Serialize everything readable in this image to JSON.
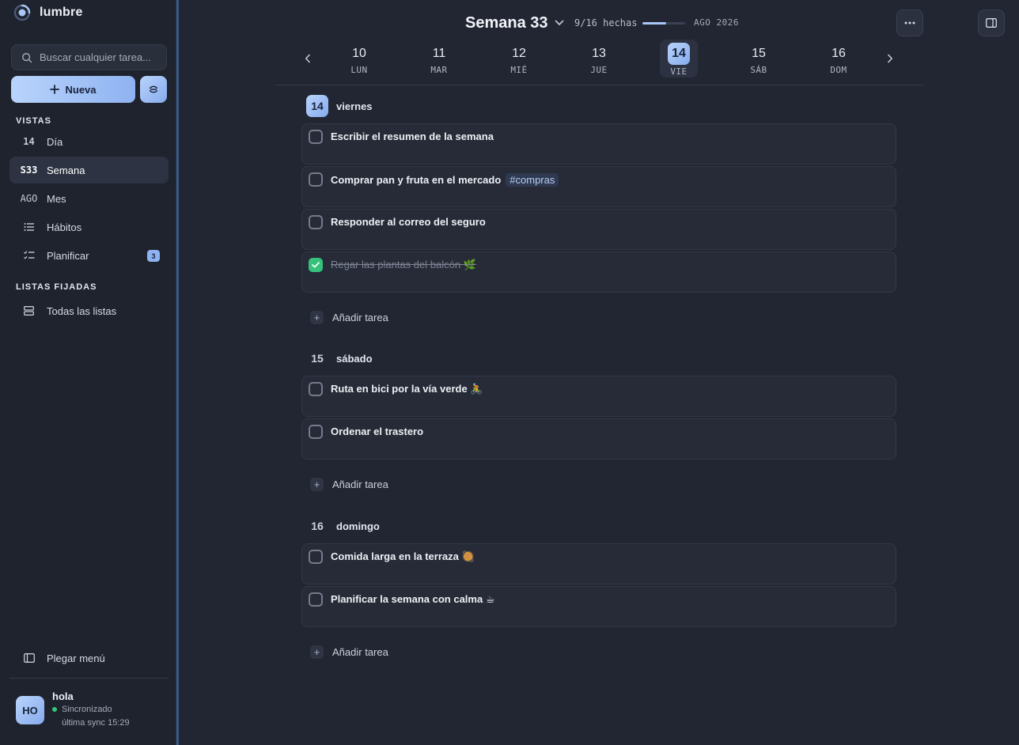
{
  "app": {
    "name": "lumbre"
  },
  "search": {
    "placeholder": "Buscar cualquier tarea..."
  },
  "sidebar": {
    "new_button": "Nueva",
    "views_label": "VISTAS",
    "views": [
      {
        "icon_text": "14",
        "label": "Día",
        "active": false
      },
      {
        "icon_text": "S33",
        "label": "Semana",
        "active": true
      },
      {
        "icon_text": "AGO",
        "label": "Mes",
        "active": false
      },
      {
        "icon": "list-icon",
        "label": "Hábitos",
        "active": false
      },
      {
        "icon": "checklist-icon",
        "label": "Planificar",
        "active": false,
        "badge": "3"
      }
    ],
    "pinned_label": "LISTAS FIJADAS",
    "pinned": [
      {
        "icon": "stack-icon",
        "label": "Todas las listas"
      }
    ],
    "collapse_label": "Plegar menú",
    "user": {
      "initials": "HO",
      "name": "hola",
      "status": "Sincronizado",
      "last_sync": "última sync 15:29"
    }
  },
  "header": {
    "week_title": "Semana 33",
    "progress_text": "9/16 hechas",
    "progress_fraction": 0.5625,
    "month": "AGO 2026"
  },
  "week": [
    {
      "num": "10",
      "dow": "LUN",
      "selected": false
    },
    {
      "num": "11",
      "dow": "MAR",
      "selected": false
    },
    {
      "num": "12",
      "dow": "MIÉ",
      "selected": false
    },
    {
      "num": "13",
      "dow": "JUE",
      "selected": false
    },
    {
      "num": "14",
      "dow": "VIE",
      "selected": true
    },
    {
      "num": "15",
      "dow": "SÁB",
      "selected": false
    },
    {
      "num": "16",
      "dow": "DOM",
      "selected": false
    }
  ],
  "add_task_label": "Añadir tarea",
  "days": [
    {
      "num": "14",
      "name": "viernes",
      "today": true,
      "tasks": [
        {
          "text": "Escribir el resumen de la semana",
          "done": false
        },
        {
          "text": "Comprar pan y fruta en el mercado",
          "tag": "#compras",
          "done": false
        },
        {
          "text": "Responder al correo del seguro",
          "done": false
        },
        {
          "text": "Regar las plantas del balcón 🌿",
          "done": true
        }
      ]
    },
    {
      "num": "15",
      "name": "sábado",
      "today": false,
      "tasks": [
        {
          "text": "Ruta en bici por la vía verde 🚴",
          "done": false
        },
        {
          "text": "Ordenar el trastero",
          "done": false
        }
      ]
    },
    {
      "num": "16",
      "name": "domingo",
      "today": false,
      "tasks": [
        {
          "text": "Comida larga en la terraza 🥘",
          "done": false
        },
        {
          "text": "Planificar la semana con calma ☕",
          "done": false
        }
      ]
    }
  ],
  "colors": {
    "accent": "#8fb3f2",
    "done": "#36c27b",
    "background": "#222633",
    "sidebar": "#1f232e"
  }
}
